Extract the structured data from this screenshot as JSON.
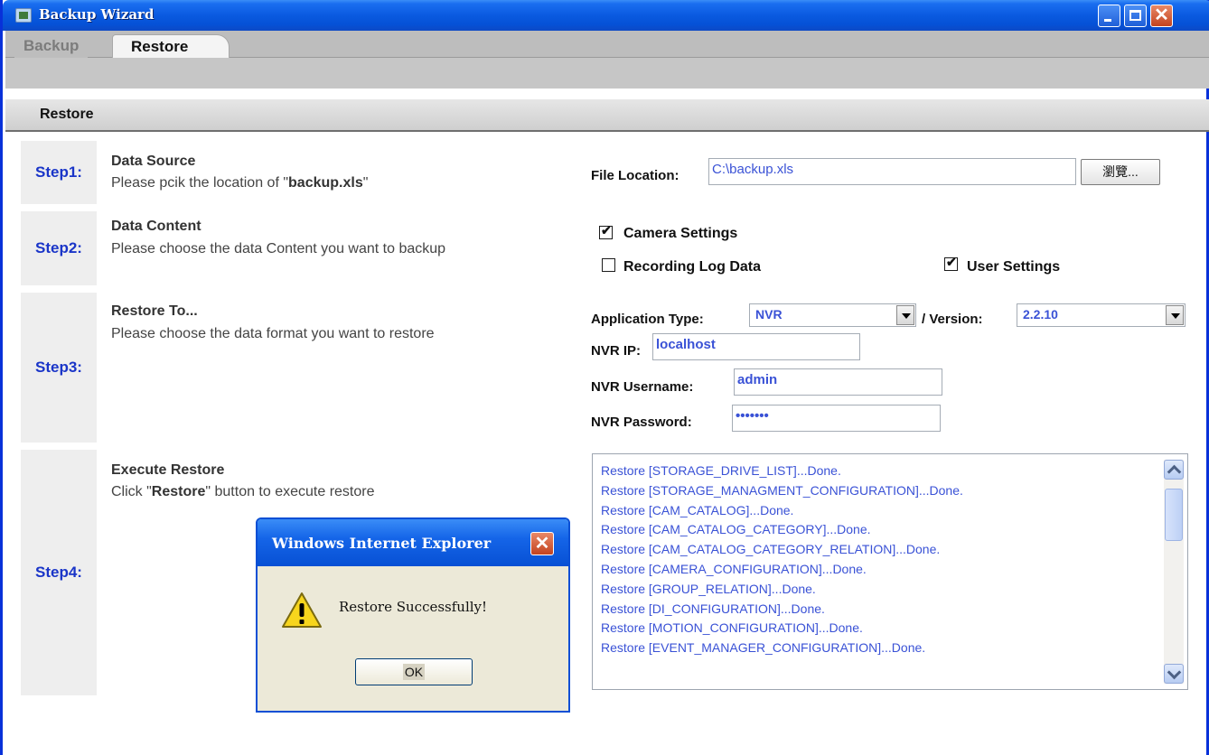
{
  "window": {
    "title": "Backup Wizard"
  },
  "tabs": [
    {
      "label": "Backup"
    },
    {
      "label": "Restore"
    }
  ],
  "subbar": {
    "label": "Restore"
  },
  "steps": [
    {
      "label": "Step1:",
      "title": "Data Source",
      "desc_prefix": "Please pcik the location of \"",
      "desc_bold": "backup.xls",
      "desc_suffix": "\""
    },
    {
      "label": "Step2:",
      "title": "Data Content",
      "desc": "Please choose the data Content you want to backup"
    },
    {
      "label": "Step3:",
      "title": "Restore To...",
      "desc": "Please choose the data format you want to restore"
    },
    {
      "label": "Step4:",
      "title": "Execute Restore",
      "desc_prefix": "Click \"",
      "desc_bold": "Restore",
      "desc_suffix": "\" button to execute restore"
    }
  ],
  "file_location": {
    "label": "File Location:",
    "value": "C:\\backup.xls",
    "browse_label": "瀏覽..."
  },
  "data_content": {
    "camera_settings": {
      "label": "Camera Settings",
      "checked": true
    },
    "recording_log": {
      "label": "Recording Log Data",
      "checked": false
    },
    "user_settings": {
      "label": "User Settings",
      "checked": true
    }
  },
  "restore_to": {
    "app_type_label": "Application Type:",
    "app_type_value": "NVR",
    "version_label": "/ Version:",
    "version_value": "2.2.10",
    "ip_label": "NVR IP:",
    "ip_value": "localhost",
    "username_label": "NVR Username:",
    "username_value": "admin",
    "password_label": "NVR Password:",
    "password_value": "•••••••"
  },
  "log_lines": [
    "Restore [STORAGE_DRIVE_LIST]...Done.",
    "Restore [STORAGE_MANAGMENT_CONFIGURATION]...Done.",
    "Restore [CAM_CATALOG]...Done.",
    "Restore [CAM_CATALOG_CATEGORY]...Done.",
    "Restore [CAM_CATALOG_CATEGORY_RELATION]...Done.",
    "Restore [CAMERA_CONFIGURATION]...Done.",
    "Restore [GROUP_RELATION]...Done.",
    "Restore [DI_CONFIGURATION]...Done.",
    "Restore [MOTION_CONFIGURATION]...Done.",
    "Restore [EVENT_MANAGER_CONFIGURATION]...Done."
  ],
  "dialog": {
    "title": "Windows Internet Explorer",
    "message": "Restore Successfully!",
    "ok_label": "OK"
  },
  "colors": {
    "titlebar": "#0a5ae0",
    "step_label": "#1a35c8",
    "input_text": "#3a52d6"
  }
}
